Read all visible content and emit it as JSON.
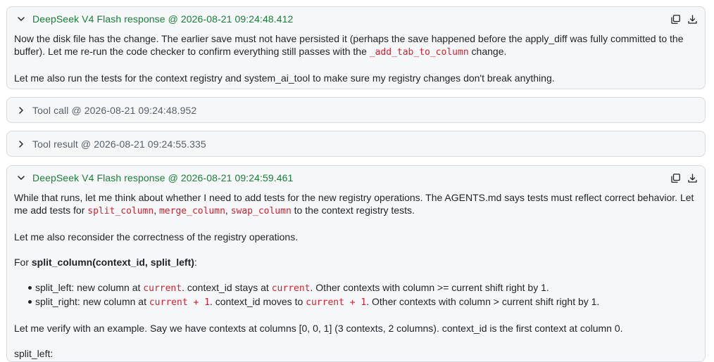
{
  "icons": {
    "collapse": "chevron-down-icon",
    "expand": "chevron-right-icon",
    "copy": "copy-icon",
    "download": "download-icon"
  },
  "colors": {
    "response_title": "#1a7f37",
    "tool_title": "#57606a",
    "code": "#cf222e",
    "card_bg": "#f6f7f9",
    "card_border": "#d7dbe0"
  },
  "response1": {
    "title": "DeepSeek V4 Flash response @ 2026-08-21 09:24:48.412",
    "p1_a": "Now the disk file has the change. The earlier save must not have persisted it (perhaps the save happened before the apply_diff was fully committed to the buffer). Let me re-run the code checker to confirm everything still passes with the ",
    "p1_code": "_add_tab_to_column",
    "p1_b": " change.",
    "p2": "Let me also run the tests for the context registry and system_ai_tool to make sure my registry changes don't break anything."
  },
  "tool_call": {
    "title": "Tool call @ 2026-08-21 09:24:48.952"
  },
  "tool_result": {
    "title": "Tool result @ 2026-08-21 09:24:55.335"
  },
  "response2": {
    "title": "DeepSeek V4 Flash response @ 2026-08-21 09:24:59.461",
    "p1_a": "While that runs, let me think about whether I need to add tests for the new registry operations. The AGENTS.md says tests must reflect correct behavior. Let me add tests for ",
    "p1_code1": "split_column",
    "p1_sep1": ", ",
    "p1_code2": "merge_column",
    "p1_sep2": ", ",
    "p1_code3": "swap_column",
    "p1_b": " to the context registry tests.",
    "p2": "Let me also reconsider the correctness of the registry operations.",
    "p3_a": "For ",
    "p3_bold": "split_column(context_id, split_left)",
    "p3_b": ":",
    "bullet1": {
      "a": "split_left: new column at ",
      "code1": "current",
      "b": ". context_id stays at ",
      "code2": "current",
      "c": ". Other contexts with column >= current shift right by 1."
    },
    "bullet2": {
      "a": "split_right: new column at ",
      "code1": "current + 1",
      "b": ". context_id moves to ",
      "code2": "current + 1",
      "c": ". Other contexts with column > current shift right by 1."
    },
    "p4": "Let me verify with an example. Say we have contexts at columns [0, 0, 1] (3 contexts, 2 columns). context_id is the first context at column 0.",
    "p5": "split_left:"
  }
}
